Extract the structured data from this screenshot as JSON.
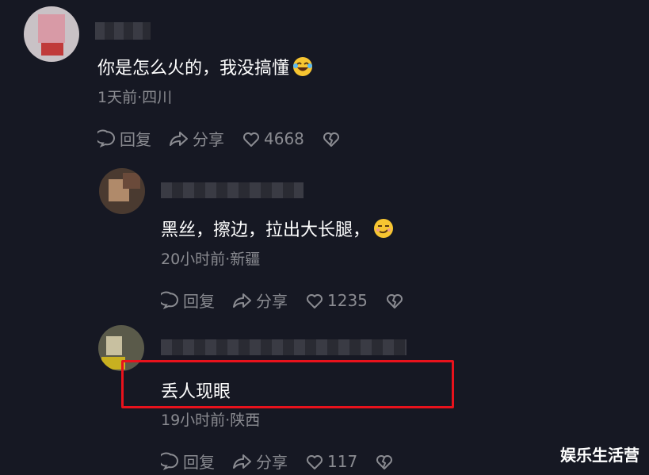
{
  "comments": [
    {
      "text": "你是怎么火的，我没搞懂",
      "meta": "1天前·四川",
      "reply_label": "回复",
      "share_label": "分享",
      "likes": "4668"
    },
    {
      "text": "黑丝，擦边，拉出大长腿，",
      "meta": "20小时前·新疆",
      "reply_label": "回复",
      "share_label": "分享",
      "likes": "1235"
    },
    {
      "text": "丢人现眼",
      "meta": "19小时前·陕西",
      "reply_label": "回复",
      "share_label": "分享",
      "likes": "117"
    }
  ],
  "watermark": "娱乐生活营",
  "colors": {
    "background": "#161823",
    "secondary_text": "#8a8b91",
    "highlight_box": "#e8121c"
  },
  "icons": [
    "comment-bubble-icon",
    "share-arrow-icon",
    "heart-icon",
    "broken-heart-icon",
    "laughing-emoji-icon",
    "smirk-emoji-icon"
  ]
}
